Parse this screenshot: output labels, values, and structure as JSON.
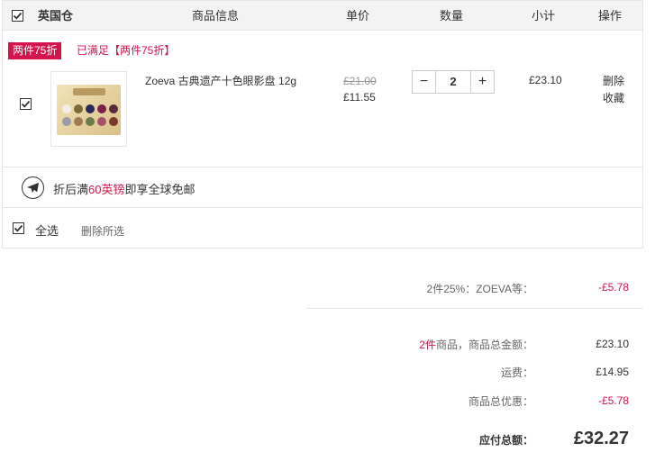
{
  "header": {
    "warehouse": "英国仓",
    "col_info": "商品信息",
    "col_price": "单价",
    "col_qty": "数量",
    "col_subtotal": "小计",
    "col_action": "操作"
  },
  "promo": {
    "tag": "两件75折",
    "met": "已满足【两件75折】"
  },
  "item": {
    "name": "Zoeva 古典遗产十色眼影盘 12g",
    "original_price": "£21.00",
    "price": "£11.55",
    "quantity": "2",
    "minus": "−",
    "plus": "+",
    "subtotal": "£23.10",
    "delete": "删除",
    "favorite": "收藏",
    "checked": true
  },
  "shipping": {
    "prefix": "折后满",
    "amount": "60英镑",
    "suffix": "即享全球免邮"
  },
  "footer": {
    "select_all": "全选",
    "delete_selected": "删除所选"
  },
  "summary": {
    "discount_label": "2件25%：ZOEVA等：",
    "discount_value": "-£5.78",
    "count": "2件",
    "goods_total_label": "商品，商品总金额：",
    "goods_total_value": "£23.10",
    "shipping_label": "运费：",
    "shipping_value": "£14.95",
    "total_discount_label": "商品总优惠：",
    "total_discount_value": "-£5.78",
    "payable_label": "应付总额：",
    "payable_value": "£32.27"
  },
  "colors": {
    "accent": "#d4144d",
    "header_bg": "#f3f3f3",
    "border": "#e6e6e6"
  },
  "palette_colors": [
    "#f4efe6",
    "#7a6a3a",
    "#2a2a55",
    "#7a1f4a",
    "#5b2a3a",
    "#9a9aa8",
    "#a07a55",
    "#6a7a4a",
    "#a3526a",
    "#7a3a2a"
  ]
}
